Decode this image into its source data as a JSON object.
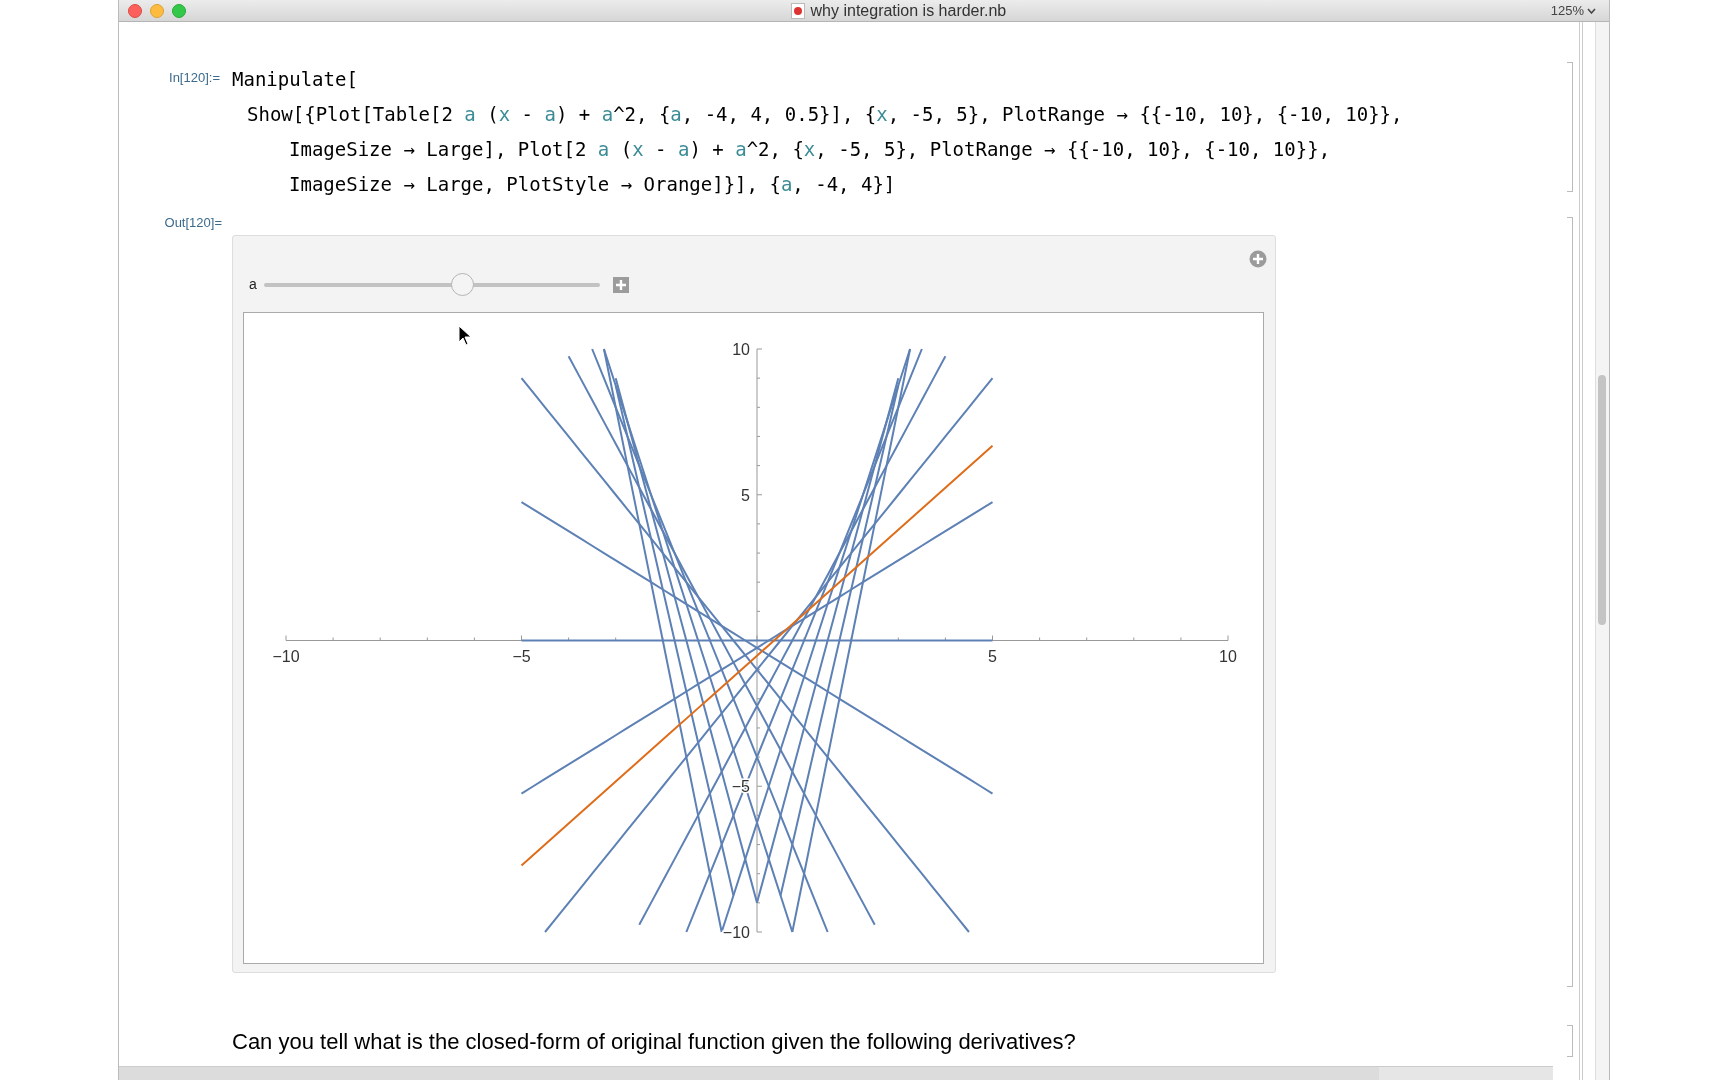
{
  "window": {
    "title": "why integration is harder.nb",
    "zoom": "125%"
  },
  "input_cell": {
    "label": "In[120]:=",
    "lines": [
      {
        "kind": "head",
        "tokens": [
          {
            "kind": "plain",
            "text": "Manipulate["
          }
        ]
      },
      {
        "kind": "body",
        "tokens": [
          {
            "kind": "plain",
            "text": "Show[{Plot[Table[2 "
          },
          {
            "kind": "var",
            "text": "a"
          },
          {
            "kind": "plain",
            "text": " ("
          },
          {
            "kind": "var",
            "text": "x"
          },
          {
            "kind": "plain",
            "text": " - "
          },
          {
            "kind": "var",
            "text": "a"
          },
          {
            "kind": "plain",
            "text": ") + "
          },
          {
            "kind": "var",
            "text": "a"
          },
          {
            "kind": "plain",
            "text": "^2, {"
          },
          {
            "kind": "var",
            "text": "a"
          },
          {
            "kind": "plain",
            "text": ", -4, 4, 0.5}], {"
          },
          {
            "kind": "var",
            "text": "x"
          },
          {
            "kind": "plain",
            "text": ", -5, 5}, PlotRange → {{-10, 10}, {-10, 10}},"
          }
        ]
      },
      {
        "kind": "wrap",
        "tokens": [
          {
            "kind": "plain",
            "text": "ImageSize → Large], Plot[2 "
          },
          {
            "kind": "var",
            "text": "a"
          },
          {
            "kind": "plain",
            "text": " ("
          },
          {
            "kind": "var",
            "text": "x"
          },
          {
            "kind": "plain",
            "text": " - "
          },
          {
            "kind": "var",
            "text": "a"
          },
          {
            "kind": "plain",
            "text": ") + "
          },
          {
            "kind": "var",
            "text": "a"
          },
          {
            "kind": "plain",
            "text": "^2, {"
          },
          {
            "kind": "var",
            "text": "x"
          },
          {
            "kind": "plain",
            "text": ", -5, 5}, PlotRange → {{-10, 10}, {-10, 10}},"
          }
        ]
      },
      {
        "kind": "wrap",
        "tokens": [
          {
            "kind": "plain",
            "text": "ImageSize → Large, PlotStyle → Orange]}], {"
          },
          {
            "kind": "var",
            "text": "a"
          },
          {
            "kind": "plain",
            "text": ", -4, 4}]"
          }
        ]
      }
    ]
  },
  "output_cell": {
    "label": "Out[120]=",
    "slider": {
      "label": "a",
      "level": 0.59
    },
    "chart_data": {
      "type": "line",
      "x": [
        -5,
        -4.75,
        -4.5,
        -4.25,
        -4,
        -3.75,
        -3.5,
        -3.25,
        -3,
        -2.75,
        -2.5,
        -2.25,
        -2,
        -1.75,
        -1.5,
        -1.25,
        -1,
        -0.75,
        -0.5,
        -0.25,
        0,
        0.25,
        0.5,
        0.75,
        1,
        1.25,
        1.5,
        1.75,
        2,
        2.25,
        2.5,
        2.75,
        3,
        3.25,
        3.5,
        3.75,
        4,
        4.25,
        4.5,
        4.75,
        5
      ],
      "xlim": [
        -10,
        10
      ],
      "ylim": [
        -10,
        10
      ],
      "xticks": [
        {
          "value": -10,
          "label": "−10"
        },
        {
          "value": -5,
          "label": "−5"
        },
        {
          "value": 5,
          "label": "5"
        },
        {
          "value": 10,
          "label": "10"
        }
      ],
      "yticks": [
        {
          "value": 10,
          "label": "10"
        },
        {
          "value": 5,
          "label": "5"
        },
        {
          "value": -5,
          "label": "−5"
        },
        {
          "value": -10,
          "label": "−10"
        }
      ],
      "series": [
        {
          "color": "#5e81b5",
          "values": [
            null,
            null,
            null,
            null,
            null,
            null,
            null,
            10,
            8,
            6,
            4,
            2,
            0,
            -2,
            -4,
            -6,
            -8,
            -10,
            null,
            null,
            null,
            null,
            null,
            null,
            null,
            null,
            null,
            null,
            null,
            null,
            null,
            null,
            null,
            null,
            null,
            null,
            null,
            null,
            null,
            null,
            null
          ]
        },
        {
          "color": "#5e81b5",
          "values": [
            null,
            null,
            null,
            null,
            null,
            null,
            null,
            null,
            8.75,
            7,
            5.25,
            3.5,
            1.75,
            0,
            -1.75,
            -3.5,
            -5.25,
            -7,
            -8.75,
            null,
            null,
            null,
            null,
            null,
            null,
            null,
            null,
            null,
            null,
            null,
            null,
            null,
            null,
            null,
            null,
            null,
            null,
            null,
            null,
            null,
            null
          ]
        },
        {
          "color": "#5e81b5",
          "values": [
            null,
            null,
            null,
            null,
            null,
            null,
            null,
            null,
            9,
            7.5,
            6,
            4.5,
            3,
            1.5,
            0,
            -1.5,
            -3,
            -4.5,
            -6,
            -7.5,
            -9,
            null,
            null,
            null,
            null,
            null,
            null,
            null,
            null,
            null,
            null,
            null,
            null,
            null,
            null,
            null,
            null,
            null,
            null,
            null,
            null
          ]
        },
        {
          "color": "#5e81b5",
          "values": [
            null,
            null,
            null,
            null,
            null,
            null,
            null,
            10,
            8.75,
            7.5,
            6.25,
            5,
            3.75,
            2.5,
            1.25,
            0,
            -1.25,
            -2.5,
            -3.75,
            -5,
            -6.25,
            -7.5,
            -8.75,
            -10,
            null,
            null,
            null,
            null,
            null,
            null,
            null,
            null,
            null,
            null,
            null,
            null,
            null,
            null,
            null,
            null,
            null
          ]
        },
        {
          "color": "#5e81b5",
          "values": [
            null,
            null,
            null,
            null,
            null,
            null,
            10,
            9,
            8,
            7,
            6,
            5,
            4,
            3,
            2,
            1,
            0,
            -1,
            -2,
            -3,
            -4,
            -5,
            -6,
            -7,
            -8,
            -9,
            -10,
            null,
            null,
            null,
            null,
            null,
            null,
            null,
            null,
            null,
            null,
            null,
            null,
            null,
            null
          ]
        },
        {
          "color": "#5e81b5",
          "values": [
            null,
            null,
            null,
            null,
            9.75,
            9,
            8.25,
            7.5,
            6.75,
            6,
            5.25,
            4.5,
            3.75,
            3,
            2.25,
            1.5,
            0.75,
            0,
            -0.75,
            -1.5,
            -2.25,
            -3,
            -3.75,
            -4.5,
            -5.25,
            -6,
            -6.75,
            -7.5,
            -8.25,
            -9,
            -9.75,
            null,
            null,
            null,
            null,
            null,
            null,
            null,
            null,
            null,
            null
          ]
        },
        {
          "color": "#5e81b5",
          "values": [
            9,
            8.5,
            8,
            7.5,
            7,
            6.5,
            6,
            5.5,
            5,
            4.5,
            4,
            3.5,
            3,
            2.5,
            2,
            1.5,
            1,
            0.5,
            0,
            -0.5,
            -1,
            -1.5,
            -2,
            -2.5,
            -3,
            -3.5,
            -4,
            -4.5,
            -5,
            -5.5,
            -6,
            -6.5,
            -7,
            -7.5,
            -8,
            -8.5,
            -9,
            -9.5,
            -10,
            null,
            null
          ]
        },
        {
          "color": "#5e81b5",
          "values": [
            4.75,
            4.5,
            4.25,
            4,
            3.75,
            3.5,
            3.25,
            3,
            2.75,
            2.5,
            2.25,
            2,
            1.75,
            1.5,
            1.25,
            1,
            0.75,
            0.5,
            0.25,
            0,
            -0.25,
            -0.5,
            -0.75,
            -1,
            -1.25,
            -1.5,
            -1.75,
            -2,
            -2.25,
            -2.5,
            -2.75,
            -3,
            -3.25,
            -3.5,
            -3.75,
            -4,
            -4.25,
            -4.5,
            -4.75,
            -5,
            -5.25
          ]
        },
        {
          "color": "#5e81b5",
          "values": [
            0,
            0,
            0,
            0,
            0,
            0,
            0,
            0,
            0,
            0,
            0,
            0,
            0,
            0,
            0,
            0,
            0,
            0,
            0,
            0,
            0,
            0,
            0,
            0,
            0,
            0,
            0,
            0,
            0,
            0,
            0,
            0,
            0,
            0,
            0,
            0,
            0,
            0,
            0,
            0,
            0
          ]
        },
        {
          "color": "#5e81b5",
          "values": [
            -5.25,
            -5,
            -4.75,
            -4.5,
            -4.25,
            -4,
            -3.75,
            -3.5,
            -3.25,
            -3,
            -2.75,
            -2.5,
            -2.25,
            -2,
            -1.75,
            -1.5,
            -1.25,
            -1,
            -0.75,
            -0.5,
            -0.25,
            0,
            0.25,
            0.5,
            0.75,
            1,
            1.25,
            1.5,
            1.75,
            2,
            2.25,
            2.5,
            2.75,
            3,
            3.25,
            3.5,
            3.75,
            4,
            4.25,
            4.5,
            4.75
          ]
        },
        {
          "color": "#5e81b5",
          "values": [
            null,
            null,
            -10,
            -9.5,
            -9,
            -8.5,
            -8,
            -7.5,
            -7,
            -6.5,
            -6,
            -5.5,
            -5,
            -4.5,
            -4,
            -3.5,
            -3,
            -2.5,
            -2,
            -1.5,
            -1,
            -0.5,
            0,
            0.5,
            1,
            1.5,
            2,
            2.5,
            3,
            3.5,
            4,
            4.5,
            5,
            5.5,
            6,
            6.5,
            7,
            7.5,
            8,
            8.5,
            9
          ]
        },
        {
          "color": "#5e81b5",
          "values": [
            null,
            null,
            null,
            null,
            null,
            null,
            null,
            null,
            null,
            null,
            -9.75,
            -9,
            -8.25,
            -7.5,
            -6.75,
            -6,
            -5.25,
            -4.5,
            -3.75,
            -3,
            -2.25,
            -1.5,
            -0.75,
            0,
            0.75,
            1.5,
            2.25,
            3,
            3.75,
            4.5,
            5.25,
            6,
            6.75,
            7.5,
            8.25,
            9,
            9.75,
            null,
            null,
            null,
            null
          ]
        },
        {
          "color": "#5e81b5",
          "values": [
            null,
            null,
            null,
            null,
            null,
            null,
            null,
            null,
            null,
            null,
            null,
            null,
            null,
            null,
            -10,
            -9,
            -8,
            -7,
            -6,
            -5,
            -4,
            -3,
            -2,
            -1,
            0,
            1,
            2,
            3,
            4,
            5,
            6,
            7,
            8,
            9,
            10,
            null,
            null,
            null,
            null,
            null,
            null
          ]
        },
        {
          "color": "#5e81b5",
          "values": [
            null,
            null,
            null,
            null,
            null,
            null,
            null,
            null,
            null,
            null,
            null,
            null,
            null,
            null,
            null,
            null,
            null,
            -10,
            -8.75,
            -7.5,
            -6.25,
            -5,
            -3.75,
            -2.5,
            -1.25,
            0,
            1.25,
            2.5,
            3.75,
            5,
            6.25,
            7.5,
            8.75,
            10,
            null,
            null,
            null,
            null,
            null,
            null,
            null
          ]
        },
        {
          "color": "#5e81b5",
          "values": [
            null,
            null,
            null,
            null,
            null,
            null,
            null,
            null,
            null,
            null,
            null,
            null,
            null,
            null,
            null,
            null,
            null,
            null,
            null,
            null,
            -9,
            -7.5,
            -6,
            -4.5,
            -3,
            -1.5,
            0,
            1.5,
            3,
            4.5,
            6,
            7.5,
            9,
            null,
            null,
            null,
            null,
            null,
            null,
            null,
            null
          ]
        },
        {
          "color": "#5e81b5",
          "values": [
            null,
            null,
            null,
            null,
            null,
            null,
            null,
            null,
            null,
            null,
            null,
            null,
            null,
            null,
            null,
            null,
            null,
            null,
            null,
            null,
            null,
            null,
            -8.75,
            -7,
            -5.25,
            -3.5,
            -1.75,
            0,
            1.75,
            3.5,
            5.25,
            7,
            8.75,
            null,
            null,
            null,
            null,
            null,
            null,
            null,
            null
          ]
        },
        {
          "color": "#5e81b5",
          "values": [
            null,
            null,
            null,
            null,
            null,
            null,
            null,
            null,
            null,
            null,
            null,
            null,
            null,
            null,
            null,
            null,
            null,
            null,
            null,
            null,
            null,
            null,
            null,
            -10,
            -8,
            -6,
            -4,
            -2,
            0,
            2,
            4,
            6,
            8,
            10,
            null,
            null,
            null,
            null,
            null,
            null,
            null
          ]
        },
        {
          "color": "#de6d1b",
          "values": [
            -7.72,
            -7.36,
            -7,
            -6.64,
            -6.28,
            -5.92,
            -5.56,
            -5.2,
            -4.84,
            -4.48,
            -4.12,
            -3.76,
            -3.4,
            -3.04,
            -2.68,
            -2.32,
            -1.96,
            -1.6,
            -1.24,
            -0.88,
            -0.52,
            -0.16,
            0.2,
            0.56,
            0.92,
            1.28,
            1.64,
            2,
            2.36,
            2.72,
            3.08,
            3.44,
            3.8,
            4.16,
            4.52,
            4.88,
            5.24,
            5.6,
            5.96,
            6.32,
            6.68
          ]
        }
      ]
    }
  },
  "text_cell": {
    "text": "Can you tell what is the closed-form of original function given the following derivatives?"
  }
}
